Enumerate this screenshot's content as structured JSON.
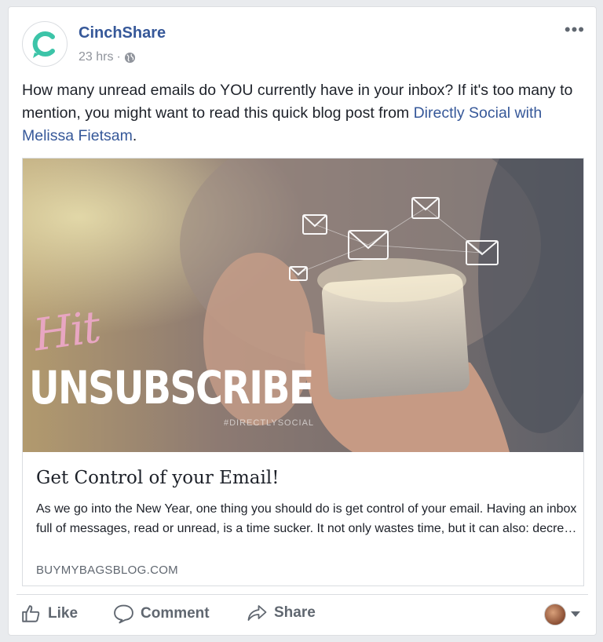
{
  "post": {
    "page_name": "CinchShare",
    "time": "23 hrs",
    "separator": "·",
    "privacy_icon": "globe-icon",
    "more_label": "•••",
    "text_before": "How many unread emails do YOU currently have in your inbox? If it's too many to mention, you might want to read this quick blog post from ",
    "link_text": "Directly Social with Melissa Fietsam",
    "text_after": "."
  },
  "preview": {
    "hero_script": "Hit",
    "hero_title": "UNSUBSCRIBE",
    "hero_tag": "#DIRECTLYSOCIAL",
    "title": "Get Control of your Email!",
    "description": "As we go into the New Year, one thing you should do is get control of your email. Having an inbox full of messages, read or unread, is a time sucker. It not only wastes time, but it can also: decre…",
    "domain": "BUYMYBAGSBLOG.COM"
  },
  "actions": {
    "like": "Like",
    "comment": "Comment",
    "share": "Share"
  },
  "colors": {
    "brand_teal": "#3cc4a8",
    "link_blue": "#365899",
    "muted": "#606770"
  }
}
